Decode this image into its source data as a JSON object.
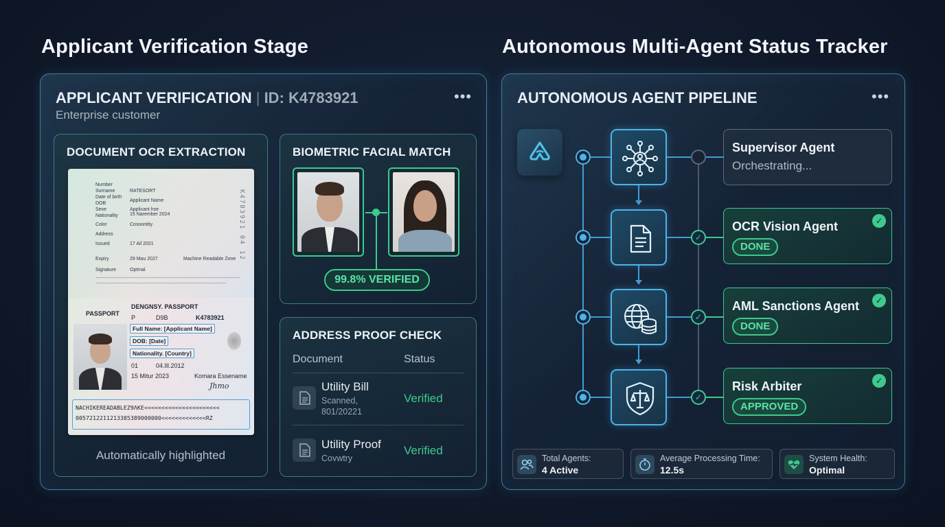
{
  "left": {
    "stage_title": "Applicant Verification Stage",
    "panel_title": "APPLICANT VERIFICATION",
    "panel_id": "ID: K4783921",
    "panel_subtitle": "Enterprise customer",
    "ocr": {
      "title": "DOCUMENT OCR EXTRACTION",
      "caption": "Automatically highlighted",
      "passport": {
        "header": "DENGNSY. PASSPORT",
        "type_label": "PASSPORT",
        "type_code": "P",
        "dob_code": "D9B",
        "number": "K4783921",
        "full_name": "Full Name: [Applicant Name]",
        "dob": "DOB: [Date]",
        "nationality": "Nationality. [Country]",
        "field_01": "01",
        "date_issue": "04.Ill.2012",
        "date_expiry": "15 Mitur 2023",
        "authority": "Komara Essename",
        "mrz_line1": "NACHIKEREADABLEZ9ΛKE<<<<<<<<<<<<<<<<<<<<<<",
        "mrz_line2": "0057212211213385389000000<<<<<<<<<<<<<RZ",
        "top_fields": [
          "Number",
          "Surname",
          "Date of birth",
          "DOB",
          "Sexe",
          "Nationality",
          "Color",
          "Address",
          "Issued",
          "Expiry",
          "Signature"
        ],
        "top_values": [
          "RATESORT",
          "Applicant Name",
          "Applicant hse",
          "15 Narember 2024",
          "Cosoontity",
          "17 Ail 2021",
          "29 Mau 2027",
          "Machine Readable Zone",
          "Optmal"
        ]
      }
    },
    "biometric": {
      "title": "BIOMETRIC FACIAL MATCH",
      "result": "99.8% VERIFIED"
    },
    "address": {
      "title": "ADDRESS PROOF CHECK",
      "col_document": "Document",
      "col_status": "Status",
      "rows": [
        {
          "name": "Utility Bill",
          "sub": "Scanned,",
          "sub2": "801/20221",
          "status": "Verified"
        },
        {
          "name": "Utility Proof",
          "sub": "Covwtry",
          "sub2": "",
          "status": "Verified"
        }
      ]
    }
  },
  "right": {
    "stage_title": "Autonomous Multi-Agent Status Tracker",
    "panel_title": "AUTONOMOUS AGENT PIPELINE",
    "agents": [
      {
        "name": "Supervisor Agent",
        "status": "Orchestrating...",
        "state": "active",
        "icon": "network-user-icon"
      },
      {
        "name": "OCR Vision Agent",
        "status": "DONE",
        "state": "done",
        "icon": "document-icon"
      },
      {
        "name": "AML Sanctions Agent",
        "status": "DONE",
        "state": "done",
        "icon": "globe-database-icon"
      },
      {
        "name": "Risk Arbiter",
        "status": "APPROVED",
        "state": "done",
        "icon": "shield-scales-icon"
      }
    ],
    "stats": [
      {
        "label": "Total Agents:",
        "value": "4 Active",
        "icon": "users-icon"
      },
      {
        "label": "Average Processing Time:",
        "value": "12.5s",
        "icon": "stopwatch-icon"
      },
      {
        "label": "System Health:",
        "value": "Optimal",
        "icon": "health-heart-icon"
      }
    ]
  },
  "colors": {
    "accent_blue": "#4fb4e6",
    "accent_green": "#3fc98f",
    "background": "#111a2b"
  }
}
